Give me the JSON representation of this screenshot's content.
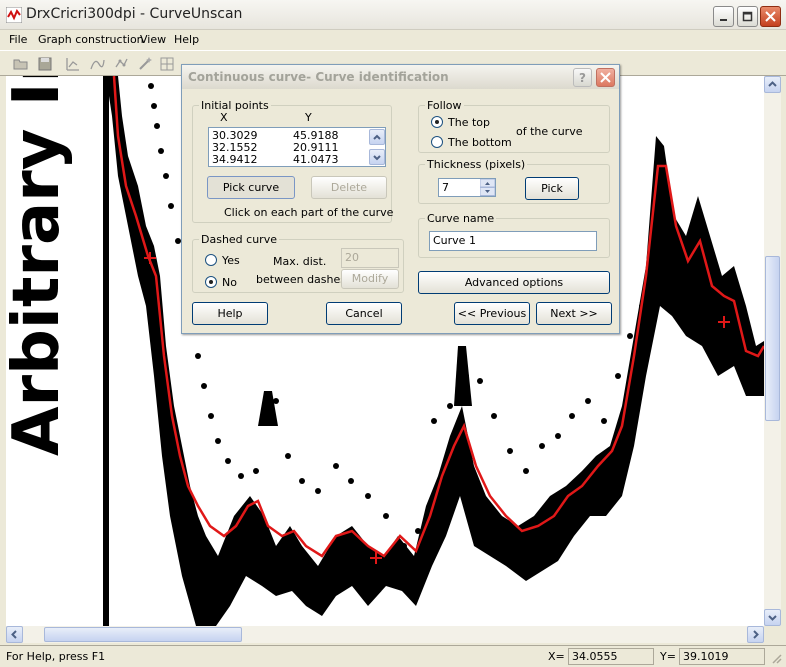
{
  "window": {
    "title": "DrxCricri300dpi - CurveUnscan"
  },
  "menu": {
    "items": [
      "File",
      "Graph construction",
      "View",
      "Help"
    ]
  },
  "toolbar": {
    "icons": [
      "open-icon",
      "save-icon",
      "axis-icon",
      "curve-icon",
      "points-icon",
      "wand-icon",
      "grid-icon",
      "export-icon"
    ]
  },
  "canvas": {
    "y_axis_label": "Arbitrary Inter"
  },
  "dialog": {
    "title": "Continuous curve- Curve identification",
    "initial_points": {
      "label": "Initial points",
      "col_x": "X",
      "col_y": "Y",
      "rows": [
        {
          "x": "30.3029",
          "y": "45.9188"
        },
        {
          "x": "32.1552",
          "y": "20.9111"
        },
        {
          "x": "34.9412",
          "y": "41.0473"
        }
      ],
      "pick_curve": "Pick curve",
      "delete": "Delete",
      "hint": "Click on each part of the curve"
    },
    "dashed": {
      "label": "Dashed curve",
      "yes": "Yes",
      "no": "No",
      "max_dist": "Max. dist.",
      "between": "between dashes",
      "value": "20",
      "modify": "Modify"
    },
    "follow": {
      "label": "Follow",
      "top": "The top",
      "bottom": "The bottom",
      "of_curve": "of the curve"
    },
    "thickness": {
      "label": "Thickness (pixels)",
      "value": "7",
      "pick": "Pick"
    },
    "curve_name": {
      "label": "Curve name",
      "value": "Curve 1"
    },
    "advanced": "Advanced options",
    "help": "Help",
    "cancel": "Cancel",
    "previous": "<< Previous",
    "next": "Next >>"
  },
  "status": {
    "help_text": "For Help, press F1",
    "x_label": "X=",
    "x_value": "34.0555",
    "y_label": "Y=",
    "y_value": "39.1019"
  },
  "colors": {
    "curve_trace": "#e01818",
    "title_close": "#c4401f"
  }
}
